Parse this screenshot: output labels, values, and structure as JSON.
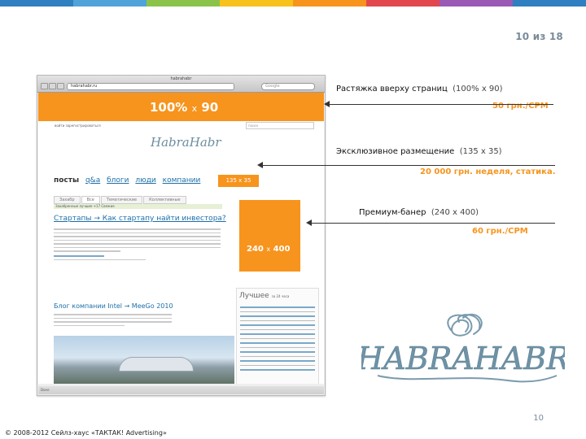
{
  "header": {
    "page_counter": "10 из 18",
    "stripe_colors": [
      "#2f7fc1",
      "#4fa3d9",
      "#8bc34a",
      "#f7c21b",
      "#f7941d",
      "#e2474d",
      "#9b59b6",
      "#2f7fc1"
    ]
  },
  "screenshot": {
    "window_title": "habrahabr",
    "url": "habrahabr.ru",
    "search_placeholder": "Google",
    "top_banner": {
      "size": "100%",
      "x": "x",
      "height": "90"
    },
    "small_links": "войти   зарегистрироваться",
    "site_search_placeholder": "поиск",
    "site_logo": "HabraHabr",
    "nav": [
      "посты",
      "q&a",
      "блоги",
      "люди",
      "компании"
    ],
    "mini_banner": "135 x 35",
    "tabs": [
      "Захабр",
      "Все",
      "Тематические",
      "Коллективные"
    ],
    "subbar": "Захабренные  лучшие +17   Свежие",
    "post_title": "Стартапы → Как стартапу найти инвестора?",
    "side_banner": {
      "w": "240",
      "x": "x",
      "h": "400"
    },
    "post_title2": "Блог компании Intel → MeeGo 2010",
    "sidebar_header": "Лучшее",
    "sidebar_header_small": "за 24 часа",
    "status": "Done"
  },
  "callouts": [
    {
      "title": "Растяжка вверху страниц",
      "dims": "(100% x 90)",
      "price": "50 грн./CPM"
    },
    {
      "title": "Эксклюзивное размещение",
      "dims": "(135 x 35)",
      "price": "20 000 грн. неделя, статика."
    },
    {
      "title": "Премиум-банер",
      "dims": "(240 x 400)",
      "price": "60 грн./CPM"
    }
  ],
  "logo_text": "HABRAHABR",
  "footer": {
    "slide_number": "10",
    "copyright": "© 2008-2012  Сейлз-хаус «ТАКТАК! Advertising»"
  },
  "colors": {
    "accent": "#f7941d",
    "link": "#1d6fa8",
    "logo": "#6b8ea0"
  }
}
